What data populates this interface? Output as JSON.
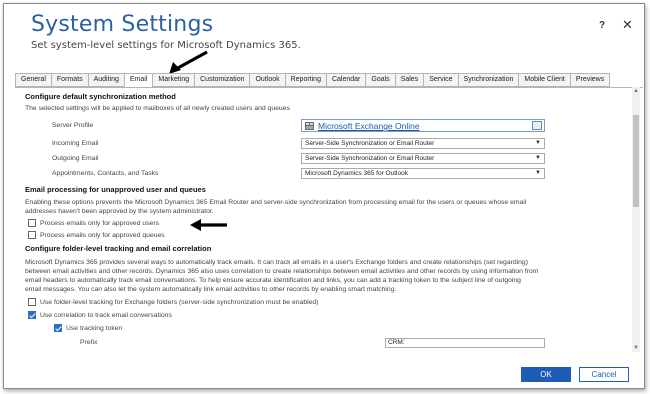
{
  "dialog": {
    "title": "System Settings",
    "subtitle": "Set system-level settings for Microsoft Dynamics 365.",
    "help_label": "?",
    "close_label": "✕"
  },
  "tabs": [
    {
      "label": "General",
      "active": false
    },
    {
      "label": "Formats",
      "active": false
    },
    {
      "label": "Auditing",
      "active": false
    },
    {
      "label": "Email",
      "active": true
    },
    {
      "label": "Marketing",
      "active": false
    },
    {
      "label": "Customization",
      "active": false
    },
    {
      "label": "Outlook",
      "active": false
    },
    {
      "label": "Reporting",
      "active": false
    },
    {
      "label": "Calendar",
      "active": false
    },
    {
      "label": "Goals",
      "active": false
    },
    {
      "label": "Sales",
      "active": false
    },
    {
      "label": "Service",
      "active": false
    },
    {
      "label": "Synchronization",
      "active": false
    },
    {
      "label": "Mobile Client",
      "active": false
    },
    {
      "label": "Previews",
      "active": false
    }
  ],
  "sync": {
    "heading": "Configure default synchronization method",
    "description": "The selected settings will be applied to mailboxes of all newly created users and queues",
    "server_profile_label": "Server Profile",
    "server_profile_value": "Microsoft Exchange Online",
    "incoming_label": "Incoming Email",
    "incoming_value": "Server-Side Synchronization or Email Router",
    "outgoing_label": "Outgoing Email",
    "outgoing_value": "Server-Side Synchronization or Email Router",
    "appointments_label": "Appointments, Contacts, and Tasks",
    "appointments_value": "Microsoft Dynamics 365 for Outlook"
  },
  "unapproved": {
    "heading": "Email processing for unapproved user and queues",
    "description_1": "Enabling these options prevents the Microsoft Dynamics 365 Email Router and server-side synchronization from processing email for the users or queues whose email",
    "description_2": "addresses haven't been approved by the system administrator.",
    "users_label": "Process emails only for approved users",
    "users_checked": false,
    "queues_label": "Process emails only for approved queues",
    "queues_checked": false
  },
  "folder": {
    "heading": "Configure folder-level tracking and email correlation",
    "line_1": "Microsoft Dynamics 365 provides several ways to automatically track emails. It can track all emails in a user's Exchange folders and create relationships (set regarding)",
    "line_2": "between email activities and other records. Dynamics 365 also uses correlation to create relationships between email activities and other records by using information from",
    "line_3": "email headers to automatically track email conversations. To help ensure accurate identification and links, you can add a tracking token to the subject line of outgoing",
    "line_4": "email messages. You can also let the system automatically link email activities to other records by enabling smart matching.",
    "folder_tracking_label": "Use folder-level tracking for Exchange folders (server-side synchronization must be enabled)",
    "folder_tracking_checked": false,
    "correlation_label": "Use correlation to track email conversations",
    "correlation_checked": true,
    "token_label": "Use tracking token",
    "token_checked": true,
    "prefix_label": "Prefix",
    "prefix_value": "CRM:"
  },
  "footer": {
    "ok_label": "OK",
    "cancel_label": "Cancel"
  },
  "colors": {
    "title": "#2d5fa4",
    "accent": "#1d5db5",
    "link": "#1d5aa8"
  },
  "icons": {
    "server_profile": "exchange-server-icon",
    "lookup": "lookup-icon",
    "annotation_arrows": "black-arrow"
  }
}
